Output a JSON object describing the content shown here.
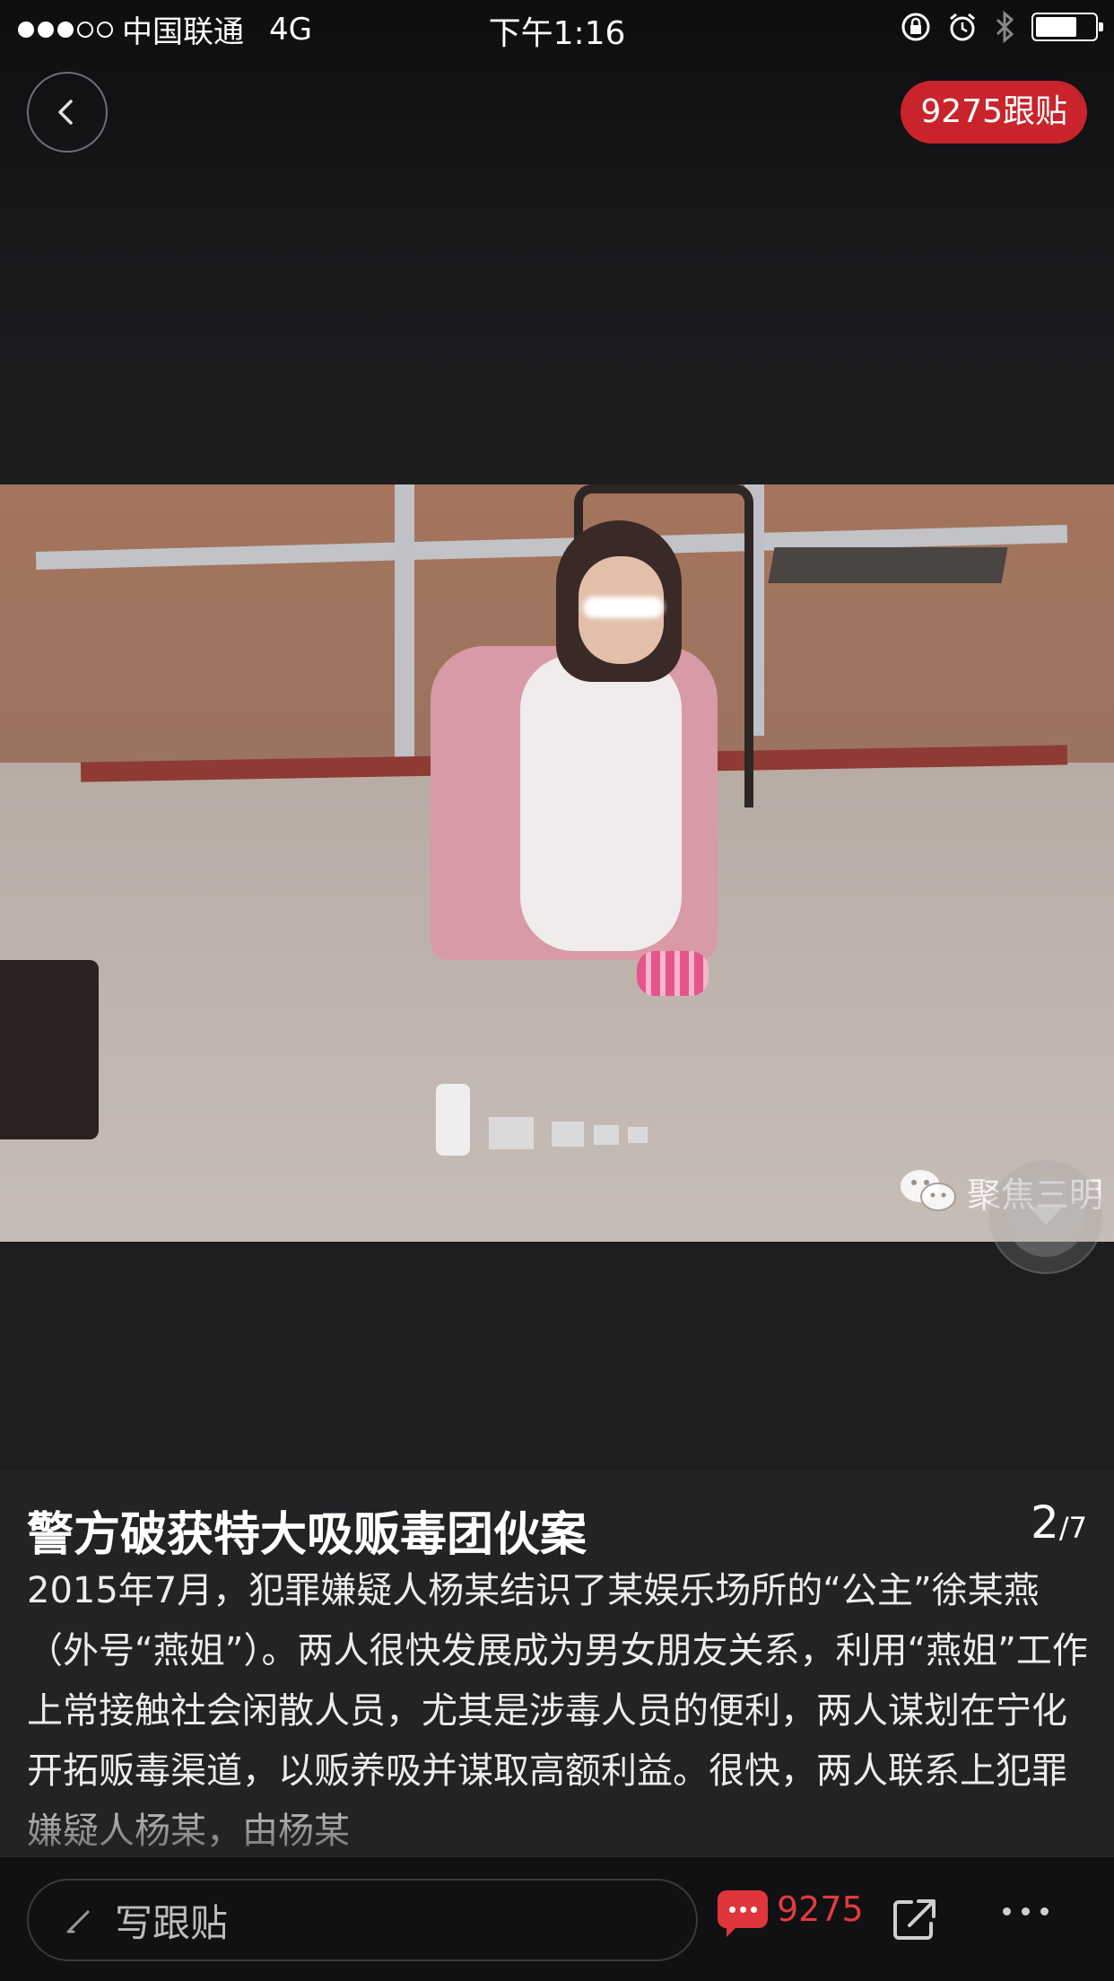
{
  "status_bar": {
    "carrier": "中国联通",
    "network": "4G",
    "time": "下午1:16",
    "signal_bars_filled": 3,
    "signal_bars_total": 5,
    "battery_level": 0.7,
    "icons": [
      "rotation-lock-icon",
      "alarm-icon",
      "bluetooth-icon",
      "battery-icon"
    ]
  },
  "nav": {
    "back_icon": "chevron-left-icon",
    "comments_label": "9275跟贴"
  },
  "photo": {
    "watermark_text": "聚焦三明",
    "watermark_icon": "wechat-icon"
  },
  "caption": {
    "title": "警方破获特大吸贩毒团伙案",
    "page_current": "2",
    "page_total": "/7",
    "body": "2015年7月，犯罪嫌疑人杨某结识了某娱乐场所的“公主”徐某燕（外号“燕姐”）。两人很快发展成为男女朋友关系，利用“燕姐”工作上常接触社会闲散人员，尤其是涉毒人员的便利，两人谋划在宁化开拓贩毒渠道，以贩养吸并谋取高额利益。很快，两人联系上犯罪嫌疑人杨某，由杨某"
  },
  "bottom_bar": {
    "input_placeholder": "写跟贴",
    "input_icon": "pencil-icon",
    "comment_count": "9275",
    "comment_icon": "chat-bubble-icon",
    "share_icon": "share-icon",
    "more_icon": "more-icon"
  },
  "colors": {
    "accent_red": "#c9242b",
    "background": "#1a191b"
  }
}
